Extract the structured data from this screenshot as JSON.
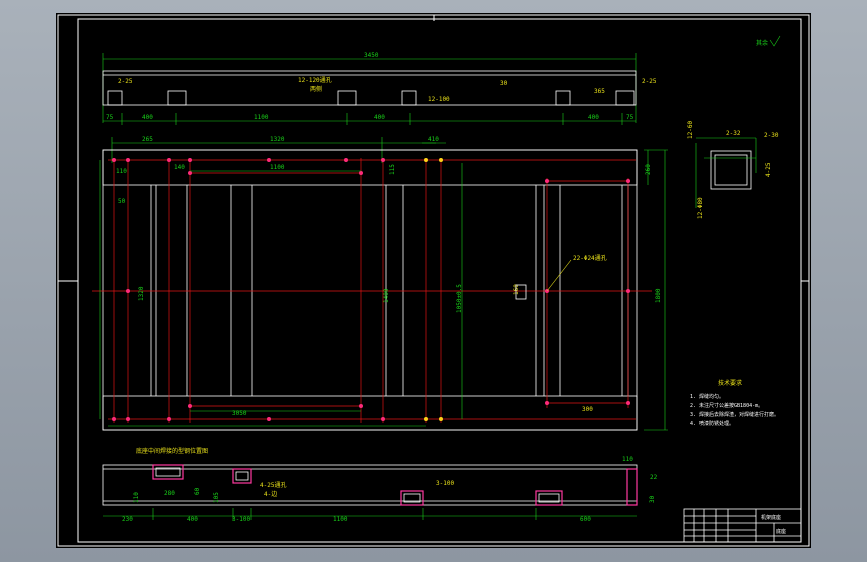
{
  "drawing": {
    "roughness_note": "其余",
    "top_view": {
      "overall": "3450",
      "left_label": "2-25",
      "right_label": "2-25",
      "holes_label": "12-120通孔",
      "holes_label2": "两侧",
      "slot_label": "12-100",
      "small_30": "30",
      "small_365": "365",
      "bottom_dims": [
        "75",
        "400",
        "1100",
        "400",
        "400",
        "75"
      ]
    },
    "plan_view": {
      "top_dims": [
        "265",
        "1320",
        "410"
      ],
      "dim_1100": "1100",
      "dim_110": "110",
      "dim_140": "140",
      "dim_115": "115",
      "dim_50": "50",
      "dim_1320v": "1320",
      "dim_1400": "1400",
      "dim_1050": "1050±0.5",
      "dim_1800": "1800",
      "dim_260": "260",
      "dim_3050": "3050",
      "dim_300": "300",
      "dim_160": "160",
      "hole_note": "22-Φ24通孔"
    },
    "section_view": {
      "dim_label": "12-60",
      "dim_label2": "2-32",
      "dim_label3": "2-30",
      "dim_4_25": "4-25",
      "dim_12_80": "12-Φ80"
    },
    "tech_req": {
      "title": "技术要求",
      "items": [
        "1. 焊缝均匀。",
        "2. 未注尺寸公差按GB1804-m。",
        "3. 焊接后去除焊渣，对焊缝进行打磨。",
        "4. 喷漆防锈处理。"
      ]
    },
    "bottom_view": {
      "note": "底座中间焊接的型钢位置图",
      "dims": [
        "110",
        "230",
        "400",
        "3-100",
        "1100",
        "600"
      ],
      "dim_280": "280",
      "dim_60": "60",
      "dim_105": "105",
      "dim_110v": "110",
      "dim_4_25": "4-25通孔",
      "dim_4_25b": "4-边",
      "dim_3_100": "3-100",
      "dim_22": "22",
      "dim_30": "30"
    },
    "title_block": {
      "name": "机架底座",
      "code": "底座"
    }
  }
}
